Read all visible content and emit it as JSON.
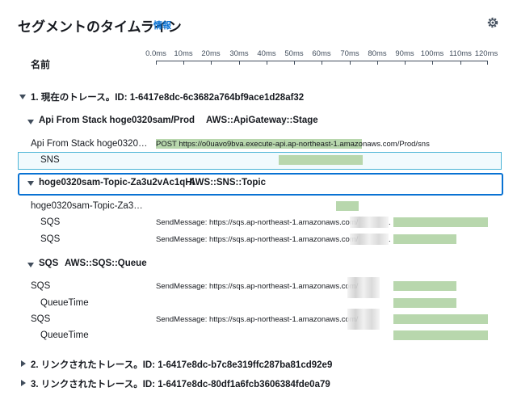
{
  "header": {
    "title": "セグメントのタイムライン",
    "info": "情報"
  },
  "columns": {
    "name": "名前"
  },
  "axis": {
    "ticks": [
      "0.0ms",
      "10ms",
      "20ms",
      "30ms",
      "40ms",
      "50ms",
      "60ms",
      "70ms",
      "80ms",
      "90ms",
      "100ms",
      "110ms",
      "120ms"
    ]
  },
  "traces": {
    "current": "1. 現在のトレース。ID: 1-6417e8dc-6c3682a764bf9ace1d28af32",
    "linked1": "2. リンクされたトレース。ID: 1-6417e8dc-b7c8e319ffc287ba81cd92e9",
    "linked2": "3. リンクされたトレース。ID: 1-6417e8dc-80df1a6fcb3606384fde0a79"
  },
  "groups": {
    "api": {
      "name": "Api From Stack hoge0320sam/Prod",
      "type": "AWS::ApiGateway::Stage"
    },
    "topic": {
      "name": "hoge0320sam-Topic-Za3u2vAc1qHi",
      "type": "AWS::SNS::Topic"
    },
    "queue": {
      "name": "SQS",
      "type": "AWS::SQS::Queue"
    }
  },
  "rows": {
    "api_segment": {
      "name": "Api From Stack hoge0320…",
      "annotation": "POST https://o0uavo9bva.execute-api.ap-northeast-1.amazonaws.com/Prod/sns"
    },
    "sns": {
      "name": "SNS"
    },
    "topic_segment": {
      "name": "hoge0320sam-Topic-Za3…"
    },
    "sqs1": {
      "name": "SQS",
      "annotation": "SendMessage: https://sqs.ap-northeast-1.amazonaws.com/",
      "suffix": "."
    },
    "sqs2": {
      "name": "SQS",
      "annotation": "SendMessage: https://sqs.ap-northeast-1.amazonaws.com/",
      "suffix": "."
    },
    "queue_sqs1": {
      "name": "SQS",
      "annotation": "SendMessage: https://sqs.ap-northeast-1.amazonaws.com/"
    },
    "queue_time1": {
      "name": "QueueTime"
    },
    "queue_sqs2": {
      "name": "SQS",
      "annotation": "SendMessage: https://sqs.ap-northeast-1.amazonaws.com/"
    },
    "queue_time2": {
      "name": "QueueTime"
    }
  },
  "colors": {
    "bar": "#b8d7ad",
    "link": "#0972d3",
    "selected_border": "#4bb4d6"
  }
}
